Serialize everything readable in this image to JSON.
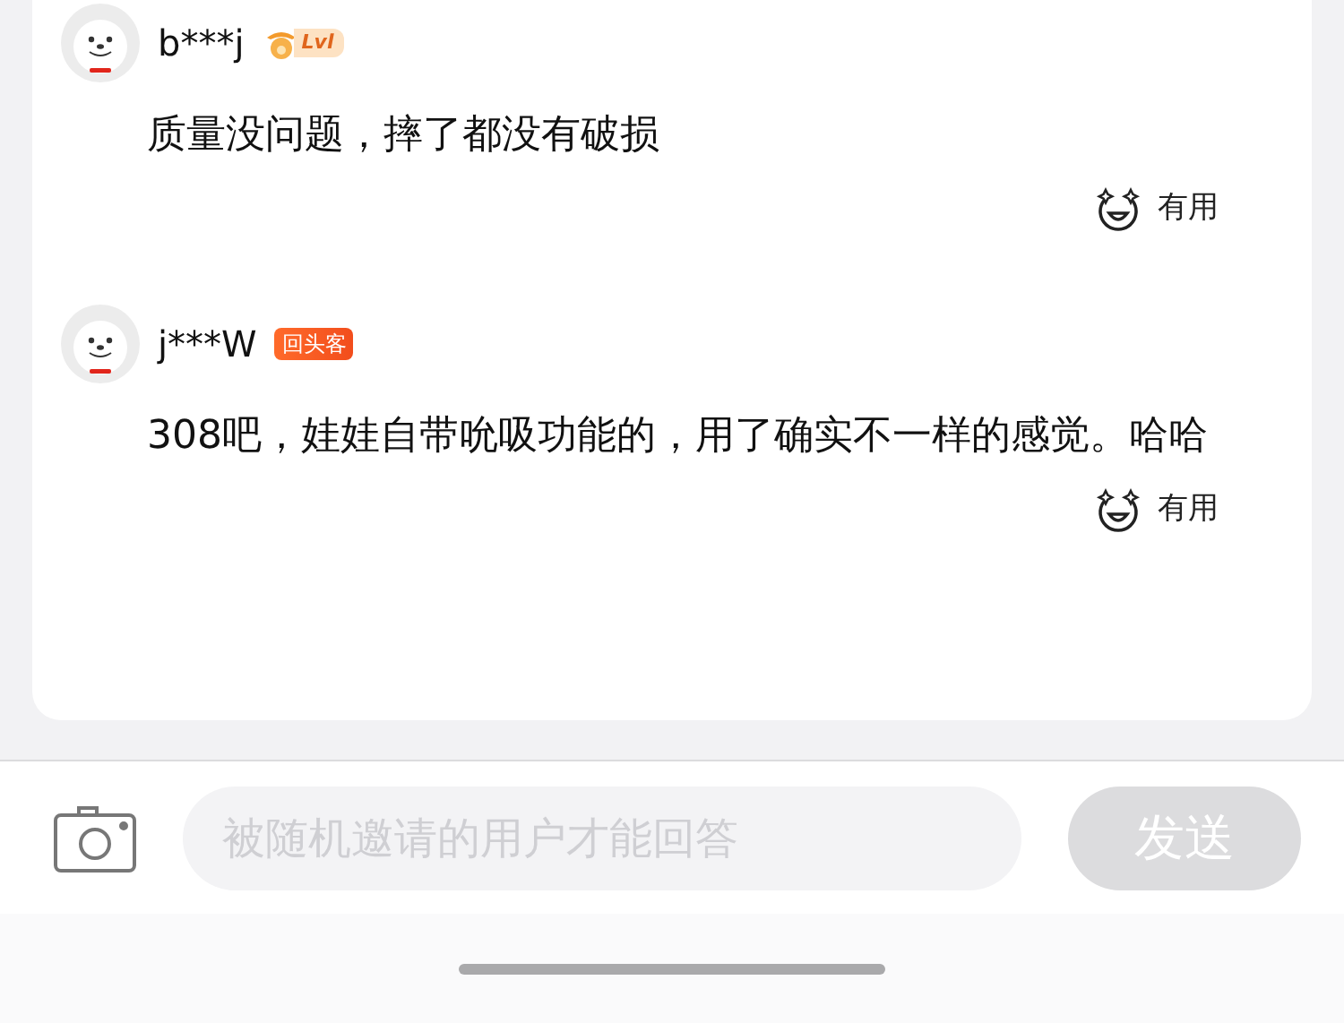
{
  "reviews": [
    {
      "user": "b***j",
      "badge": {
        "kind": "level",
        "text": "Lvl"
      },
      "text": "质量没问题，摔了都没有破损",
      "useful": "有用"
    },
    {
      "user": "j***W",
      "badge": {
        "kind": "tag",
        "text": "回头客"
      },
      "text": "308吧，娃娃自带吮吸功能的，用了确实不一样的感觉。哈哈",
      "useful": "有用"
    }
  ],
  "composer": {
    "placeholder": "被随机邀请的用户才能回答",
    "send": {
      "label": "发送",
      "disabled": true
    }
  }
}
